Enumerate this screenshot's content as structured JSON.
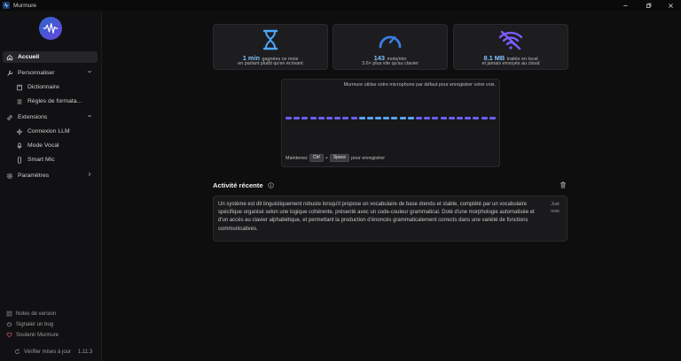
{
  "window": {
    "title": "Murmure",
    "controls": [
      "minimize-icon",
      "maximize-icon",
      "close-icon"
    ]
  },
  "sidebar": {
    "logo": "murmure-logo",
    "items": [
      {
        "label": "Accueil",
        "icon": "home-icon",
        "active": true
      },
      {
        "label": "Personnaliser",
        "icon": "wrench-icon",
        "expanded": true
      },
      {
        "label": "Dictionnaire",
        "icon": "book-icon"
      },
      {
        "label": "Règles de formata...",
        "icon": "list-icon"
      },
      {
        "label": "Extensions",
        "icon": "link-icon",
        "expanded": true
      },
      {
        "label": "Connexion LLM",
        "icon": "sparkle-icon"
      },
      {
        "label": "Mode Vocal",
        "icon": "mic-icon"
      },
      {
        "label": "Smart Mic",
        "icon": "phone-icon"
      },
      {
        "label": "Paramètres",
        "icon": "gear-icon",
        "expanded": false
      }
    ],
    "footer": {
      "release_notes": "Notes de version",
      "report_bug": "Signaler un bug",
      "support": "Soutenir Murmure",
      "check_updates": "Vérifier mises à jour",
      "version": "1.11.3"
    }
  },
  "stats": [
    {
      "icon": "hourglass-icon",
      "value": "1 min",
      "line1": "gagnées ce mois",
      "line2": "en parlant plutôt qu'en écrivant",
      "color": "#4aa8ff"
    },
    {
      "icon": "speedometer-icon",
      "value": "143",
      "line1": "mots/min",
      "line2": "3.6× plus vite qu'au clavier",
      "color": "#3b7de0"
    },
    {
      "icon": "wifi-off-icon",
      "value": "8.1 MB",
      "line1": "traités en local",
      "line2": "et jamais envoyés au cloud",
      "color": "#7b5cff"
    }
  ],
  "mic": {
    "note": "Murmure utilise votre microphone par défaut pour enregistrer votre voix.",
    "hint_before": "Maintenez",
    "key1": "Ctrl",
    "plus": "+",
    "key2": "Space",
    "hint_after": "pour enregistrer",
    "wave_colors": [
      "#6d5cf0",
      "#5aa3f0"
    ]
  },
  "activity": {
    "title": "Activité récente",
    "items": [
      {
        "text": "Un système est dit linguistiquement robuste lorsqu'il propose un vocabulaire de base étendu et stable, complété par un vocabulaire spécifique organisé selon une logique cohérente, présenté avec un code-couleur grammatical. Doté d'une morphologie automatisée et d'un accès au clavier alphabétique, et permettant la production d'énoncés grammaticalement corrects dans une variété de fonctions communicatives.",
        "time_line1": "Just",
        "time_line2": "now"
      }
    ]
  }
}
